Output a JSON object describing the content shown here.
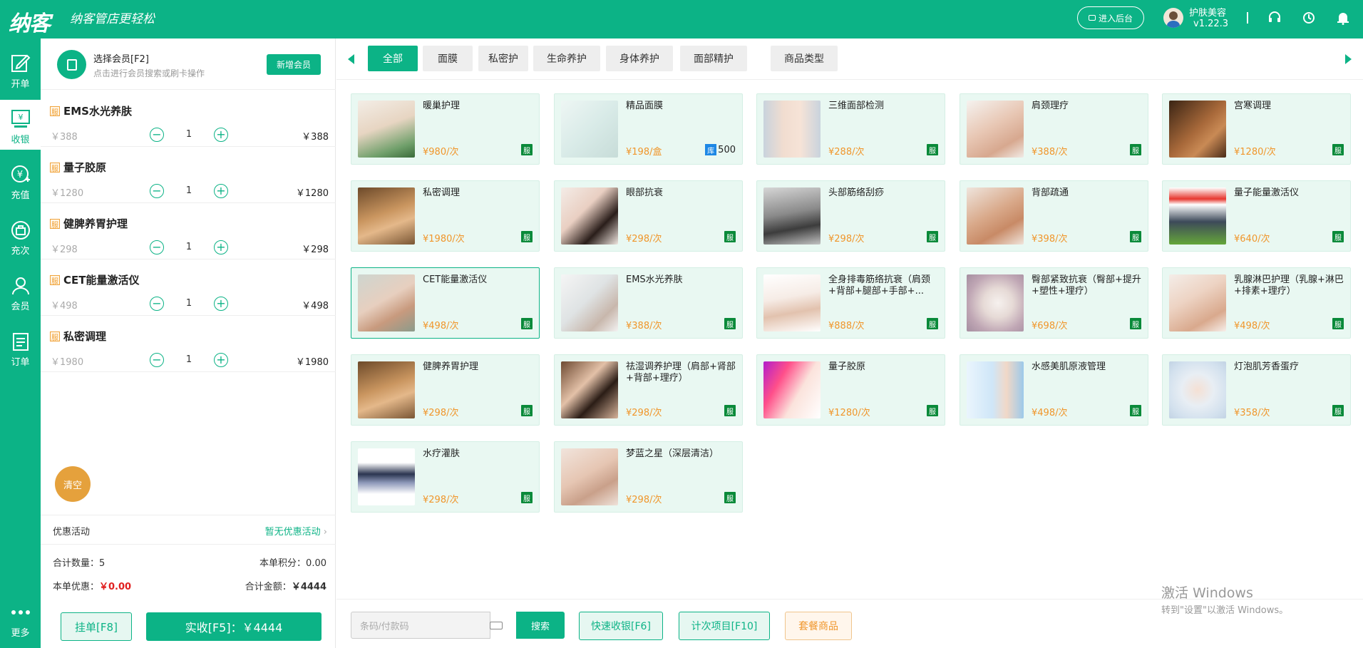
{
  "app": {
    "logo": "纳客",
    "slogan": "纳客管店更轻松",
    "backend_label": "进入后台",
    "user_name": "护肤美容",
    "version": "v1.22.3"
  },
  "nav": [
    {
      "label": "开单",
      "icon": "edit-icon"
    },
    {
      "label": "收银",
      "icon": "cashier-icon"
    },
    {
      "label": "充值",
      "icon": "yen-icon"
    },
    {
      "label": "充次",
      "icon": "bag-icon"
    },
    {
      "label": "会员",
      "icon": "user-icon"
    },
    {
      "label": "订单",
      "icon": "list-icon"
    },
    {
      "label": "更多",
      "icon": "more-icon"
    }
  ],
  "member": {
    "title": "选择会员[F2]",
    "subtitle": "点击进行会员搜索或刷卡操作",
    "new_label": "新增会员"
  },
  "cart": [
    {
      "tag": "服",
      "name": "EMS水光养肤",
      "orig": "￥388",
      "qty": "1",
      "total": "￥388"
    },
    {
      "tag": "服",
      "name": "量子胶原",
      "orig": "￥1280",
      "qty": "1",
      "total": "￥1280"
    },
    {
      "tag": "服",
      "name": "健脾养胃护理",
      "orig": "￥298",
      "qty": "1",
      "total": "￥298"
    },
    {
      "tag": "服",
      "name": "CET能量激活仪",
      "orig": "￥498",
      "qty": "1",
      "total": "￥498"
    },
    {
      "tag": "服",
      "name": "私密调理",
      "orig": "￥1980",
      "qty": "1",
      "total": "￥1980"
    }
  ],
  "clear_label": "清空",
  "promo": {
    "label": "优惠活动",
    "value": "暂无优惠活动"
  },
  "summary": {
    "count_label": "合计数量：",
    "count": "5",
    "points_label": "本单积分：",
    "points": "0.00",
    "discount_label": "本单优惠：",
    "discount": "￥0.00",
    "amount_label": "合计金额：",
    "amount": "￥4444"
  },
  "actions": {
    "hold": "挂单[F8]",
    "pay": "实收[F5]：￥4444"
  },
  "tabs": [
    "全部",
    "面膜",
    "私密护",
    "生命养护",
    "身体养护",
    "面部精护",
    "商品类型"
  ],
  "products": [
    {
      "name": "暖巢护理",
      "price": "¥980/次",
      "badge": "服"
    },
    {
      "name": "精品面膜",
      "price": "¥198/盒",
      "stock_tag": "库",
      "stock": "500"
    },
    {
      "name": "三维面部检测",
      "price": "¥288/次",
      "badge": "服"
    },
    {
      "name": "肩颈理疗",
      "price": "¥388/次",
      "badge": "服"
    },
    {
      "name": "宫寒调理",
      "price": "¥1280/次",
      "badge": "服"
    },
    {
      "name": "私密调理",
      "price": "¥1980/次",
      "badge": "服"
    },
    {
      "name": "眼部抗衰",
      "price": "¥298/次",
      "badge": "服"
    },
    {
      "name": "头部筋络刮痧",
      "price": "¥298/次",
      "badge": "服"
    },
    {
      "name": "背部疏通",
      "price": "¥398/次",
      "badge": "服"
    },
    {
      "name": "量子能量激活仪",
      "price": "¥640/次",
      "badge": "服"
    },
    {
      "name": "CET能量激活仪",
      "price": "¥498/次",
      "badge": "服"
    },
    {
      "name": "EMS水光养肤",
      "price": "¥388/次",
      "badge": "服"
    },
    {
      "name": "全身排毒筋络抗衰（肩颈+背部+腿部+手部+...",
      "price": "¥888/次",
      "badge": "服"
    },
    {
      "name": "臀部紧致抗衰（臀部+提升+塑性+理疗）",
      "price": "¥698/次",
      "badge": "服"
    },
    {
      "name": "乳腺淋巴护理（乳腺+淋巴+排素+理疗）",
      "price": "¥498/次",
      "badge": "服"
    },
    {
      "name": "健脾养胃护理",
      "price": "¥298/次",
      "badge": "服"
    },
    {
      "name": "祛湿调养护理（肩部+肾部+背部+理疗）",
      "price": "¥298/次",
      "badge": "服"
    },
    {
      "name": "量子胶原",
      "price": "¥1280/次",
      "badge": "服"
    },
    {
      "name": "水感美肌原液管理",
      "price": "¥498/次",
      "badge": "服"
    },
    {
      "name": "灯泡肌芳香蛋疗",
      "price": "¥358/次",
      "badge": "服"
    },
    {
      "name": "水疗灌肤",
      "price": "¥298/次",
      "badge": "服"
    },
    {
      "name": "梦蓝之星（深层清洁）",
      "price": "¥298/次",
      "badge": "服"
    }
  ],
  "bottom": {
    "code_placeholder": "条码/付款码",
    "search": "搜索",
    "quick": "快速收银[F6]",
    "count_item": "计次项目[F10]",
    "package": "套餐商品"
  },
  "watermark": {
    "line1": "激活 Windows",
    "line2": "转到\"设置\"以激活 Windows。"
  },
  "colors": {
    "accent": "#0cb386",
    "price": "#f0962b",
    "service_badge": "#0a8a3a",
    "clear": "#e5a13c"
  }
}
